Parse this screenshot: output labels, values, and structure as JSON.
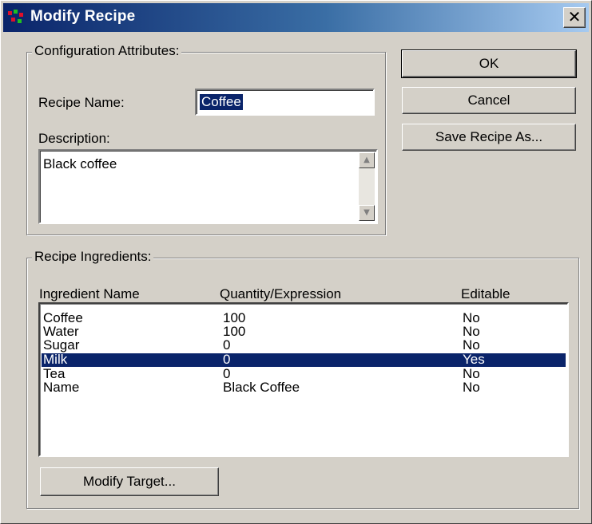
{
  "window": {
    "title": "Modify Recipe",
    "close_glyph": "✕"
  },
  "config_group": {
    "legend": "Configuration Attributes:",
    "recipe_name_label": "Recipe Name:",
    "recipe_name_value": "Coffee",
    "description_label": "Description:",
    "description_value": "Black coffee"
  },
  "buttons": {
    "ok": "OK",
    "cancel": "Cancel",
    "save_as": "Save Recipe As...",
    "modify_target": "Modify Target..."
  },
  "ingredients_group": {
    "legend": "Recipe Ingredients:",
    "columns": [
      "Ingredient Name",
      "Quantity/Expression",
      "Editable"
    ],
    "rows": [
      {
        "name": "Coffee",
        "quantity": "100",
        "editable": "No"
      },
      {
        "name": "Water",
        "quantity": "100",
        "editable": "No"
      },
      {
        "name": "Sugar",
        "quantity": "0",
        "editable": "No"
      },
      {
        "name": "Milk",
        "quantity": "0",
        "editable": "Yes",
        "selected": true
      },
      {
        "name": "Tea",
        "quantity": "0",
        "editable": "No"
      },
      {
        "name": "Name",
        "quantity": "Black Coffee",
        "editable": "No"
      }
    ]
  },
  "colors": {
    "selection": "#0a246a",
    "face": "#d4d0c8"
  }
}
